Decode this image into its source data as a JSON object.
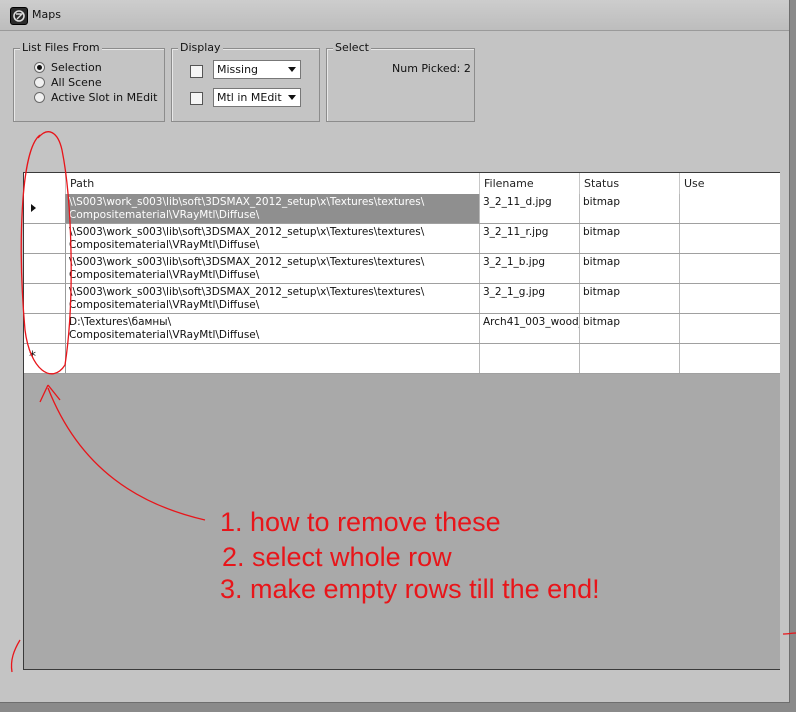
{
  "window": {
    "title": "Maps",
    "icon": "3ds-max-logo-icon"
  },
  "list_files_from": {
    "label": "List Files From",
    "options": [
      {
        "label": "Selection",
        "checked": true
      },
      {
        "label": "All Scene",
        "checked": false
      },
      {
        "label": "Active Slot in MEdit",
        "checked": false
      }
    ]
  },
  "display": {
    "label": "Display",
    "rows": [
      {
        "checked": false,
        "selected": "Missing"
      },
      {
        "checked": false,
        "selected": "Mtl in MEdit"
      }
    ]
  },
  "select": {
    "label": "Select",
    "num_picked": "Num Picked: 2"
  },
  "table": {
    "columns": [
      "Path",
      "Filename",
      "Status",
      "Use"
    ],
    "rows": [
      {
        "path1": "\\\\S003\\work_s003\\lib\\soft\\3DSMAX_2012_setup\\x\\Textures\\textures\\",
        "path2": "Compositematerial\\VRayMtl\\Diffuse\\",
        "filename": "3_2_11_d.jpg",
        "status": "bitmap",
        "use": ""
      },
      {
        "path1": "\\\\S003\\work_s003\\lib\\soft\\3DSMAX_2012_setup\\x\\Textures\\textures\\",
        "path2": "Compositematerial\\VRayMtl\\Diffuse\\",
        "filename": "3_2_11_r.jpg",
        "status": "bitmap",
        "use": ""
      },
      {
        "path1": "\\\\S003\\work_s003\\lib\\soft\\3DSMAX_2012_setup\\x\\Textures\\textures\\",
        "path2": "Compositematerial\\VRayMtl\\Diffuse\\",
        "filename": "3_2_1_b.jpg",
        "status": "bitmap",
        "use": ""
      },
      {
        "path1": "\\\\S003\\work_s003\\lib\\soft\\3DSMAX_2012_setup\\x\\Textures\\textures\\",
        "path2": "Compositematerial\\VRayMtl\\Diffuse\\",
        "filename": "3_2_1_g.jpg",
        "status": "bitmap",
        "use": ""
      },
      {
        "path1": "D:\\Textures\\бамны\\",
        "path2": "Compositematerial\\VRayMtl\\Diffuse\\",
        "filename": "Arch41_003_wood_",
        "status": "bitmap",
        "use": ""
      }
    ],
    "new_row_marker": "*"
  },
  "annotations": [
    "1. how to remove these",
    "2. select whole row",
    "3. make empty rows till the end!"
  ],
  "colors": {
    "annotation": "#e8151a",
    "selected_cell": "#8f8f8f",
    "grid_empty": "#a9a9a9"
  }
}
